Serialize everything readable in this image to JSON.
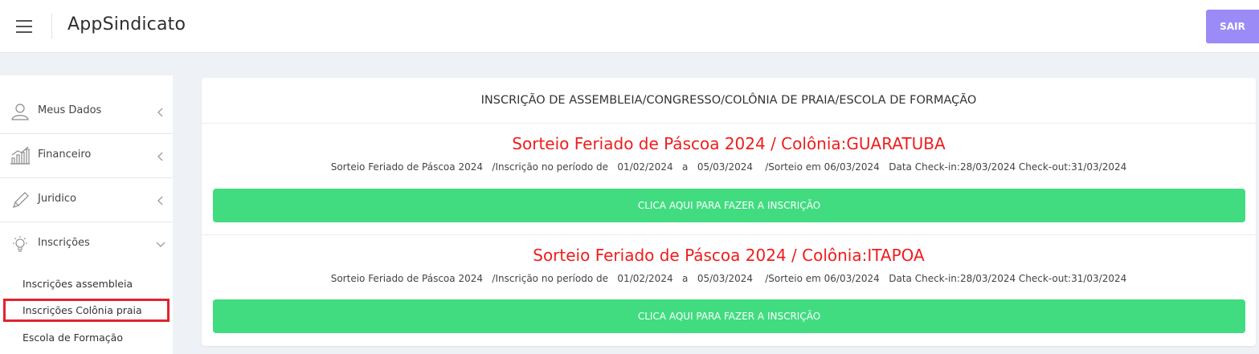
{
  "header": {
    "brand": "AppSindicato",
    "logout_label": "SAIR",
    "icons": {
      "menu": "hamburger-icon"
    },
    "colors": {
      "logout_bg": "#9b8bf7"
    }
  },
  "sidebar": {
    "items": [
      {
        "label": "Meus Dados",
        "icon": "user-icon",
        "chevron": "chevron-left-icon"
      },
      {
        "label": "Financeiro",
        "icon": "bar-chart-icon",
        "chevron": "chevron-left-icon"
      },
      {
        "label": "Juridico",
        "icon": "pencil-icon",
        "chevron": "chevron-left-icon"
      },
      {
        "label": "Inscrições",
        "icon": "lightbulb-icon",
        "chevron": "chevron-down-icon"
      }
    ],
    "subitems": [
      {
        "label": "Inscrições assembleia"
      },
      {
        "label": "Inscrições Colônia praia",
        "highlighted": true
      },
      {
        "label": "Escola de Formação"
      }
    ],
    "colors": {
      "highlight_border": "#e0242e"
    }
  },
  "main": {
    "title": "INSCRIÇÃO DE ASSEMBLEIA/CONGRESSO/COLÔNIA DE PRAIA/ESCOLA DE FORMAÇÃO",
    "entries": [
      {
        "title": "Sorteio Feriado de Páscoa 2024 / Colônia:GUARATUBA",
        "info": "Sorteio Feriado de Páscoa 2024   /Inscrição no período de   01/02/2024   a   05/03/2024    /Sorteio em 06/03/2024   Data Check-in:28/03/2024 Check-out:31/03/2024",
        "button_label": "CLICA AQUI PARA FAZER A INSCRIÇÃO"
      },
      {
        "title": "Sorteio Feriado de Páscoa 2024 / Colônia:ITAPOA",
        "info": "Sorteio Feriado de Páscoa 2024   /Inscrição no período de   01/02/2024   a   05/03/2024    /Sorteio em 06/03/2024   Data Check-in:28/03/2024 Check-out:31/03/2024",
        "button_label": "CLICA AQUI PARA FAZER A INSCRIÇÃO"
      }
    ],
    "colors": {
      "title_red": "#f01c1c",
      "button_green": "#41dc80"
    }
  }
}
